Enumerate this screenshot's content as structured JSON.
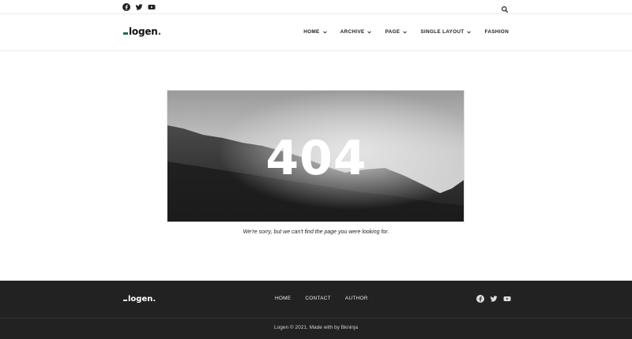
{
  "topbar": {
    "social_icons": [
      "facebook-icon",
      "twitter-icon",
      "youtube-icon"
    ],
    "search_icon": "search-icon"
  },
  "header": {
    "logo_text": "logen",
    "logo_dot": ".",
    "brand_color": "#1f6b45",
    "nav": [
      {
        "label": "HOME",
        "has_dropdown": true
      },
      {
        "label": "ARCHIVE",
        "has_dropdown": true
      },
      {
        "label": "PAGE",
        "has_dropdown": true
      },
      {
        "label": "SINGLE LAYOUT",
        "has_dropdown": true
      },
      {
        "label": "FASHION",
        "has_dropdown": false
      }
    ]
  },
  "main": {
    "error_code": "404",
    "message": "We're sorry, but we can't find the page you were looking for."
  },
  "footer": {
    "logo_text": "logen",
    "logo_dot": ".",
    "nav": [
      {
        "label": "HOME"
      },
      {
        "label": "CONTACT"
      },
      {
        "label": "AUTHOR"
      }
    ],
    "social_icons": [
      "facebook-icon",
      "twitter-icon",
      "youtube-icon"
    ],
    "copyright": "Logen © 2021. Made with by Bkninja",
    "background_color": "#222222"
  }
}
